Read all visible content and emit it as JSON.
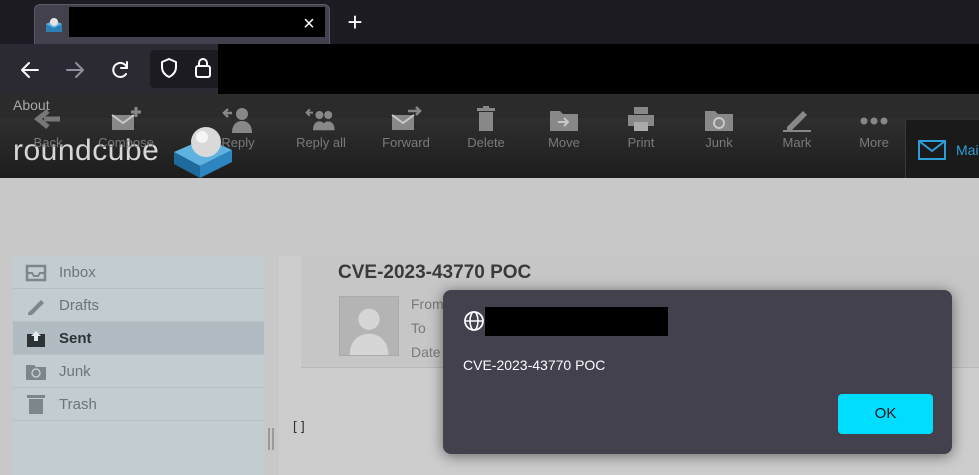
{
  "browser": {
    "tab_close_glyph": "×",
    "new_tab_glyph": "+"
  },
  "roundcube": {
    "about_link": "About",
    "logo_text": "roundcube",
    "mail_tab_label": "Mail"
  },
  "toolbar": {
    "buttons": [
      {
        "label": "Back",
        "icon": "back-arrow-icon"
      },
      {
        "label": "Compose",
        "icon": "compose-icon"
      },
      {
        "label": "Reply",
        "icon": "reply-icon"
      },
      {
        "label": "Reply all",
        "icon": "reply-all-icon"
      },
      {
        "label": "Forward",
        "icon": "forward-icon"
      },
      {
        "label": "Delete",
        "icon": "trash-icon"
      },
      {
        "label": "Move",
        "icon": "move-folder-icon"
      },
      {
        "label": "Print",
        "icon": "printer-icon"
      },
      {
        "label": "Junk",
        "icon": "junk-icon"
      },
      {
        "label": "Mark",
        "icon": "mark-pencil-icon"
      },
      {
        "label": "More",
        "icon": "more-dots-icon"
      }
    ]
  },
  "folders": [
    {
      "label": "Inbox",
      "icon": "inbox-icon",
      "active": false
    },
    {
      "label": "Drafts",
      "icon": "drafts-pencil-icon",
      "active": false
    },
    {
      "label": "Sent",
      "icon": "sent-icon",
      "active": true
    },
    {
      "label": "Junk",
      "icon": "junk-folder-icon",
      "active": false
    },
    {
      "label": "Trash",
      "icon": "trash-folder-icon",
      "active": false
    }
  ],
  "message": {
    "subject": "CVE-2023-43770 POC",
    "from_label": "From",
    "to_label": "To",
    "date_label": "Date",
    "body": "[]"
  },
  "dialog": {
    "message": "CVE-2023-43770 POC",
    "ok_label": "OK"
  },
  "colors": {
    "accent": "#00ddff",
    "roundcube_blue": "#2d9fd8"
  }
}
